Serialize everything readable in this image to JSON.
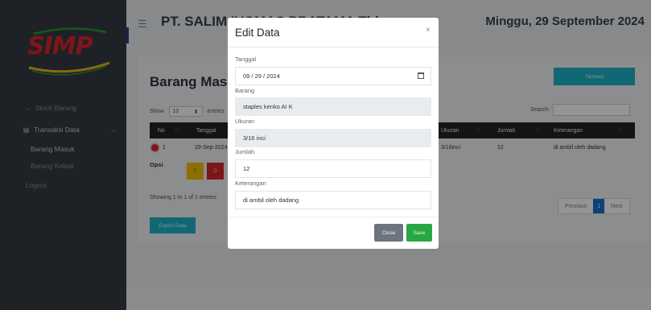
{
  "sidebar": {
    "logo_text": "SIMP",
    "items": [
      {
        "label": "Stock Barang",
        "icon": "arrow-right-icon"
      },
      {
        "label": "Transaksi Data",
        "icon": "table-icon"
      }
    ],
    "subitems": [
      {
        "label": "Barang Masuk"
      },
      {
        "label": "Barang Keluar"
      }
    ],
    "logout_label": "Logout"
  },
  "topbar": {
    "company": "PT. SALIM IVOMAS PRATAMA Tbk",
    "date": "Minggu, 29 September 2024"
  },
  "card": {
    "title": "Barang Masuk",
    "tambah_label": "Tambah",
    "show_label": "Show",
    "show_value": "10",
    "entries_label": "entries",
    "search_label": "Search:",
    "columns": {
      "no": "No",
      "tanggal": "Tanggal",
      "ukuran": "Ukuran",
      "jumlah": "Jumlah",
      "keterangan": "Keterangan"
    },
    "row": {
      "no": "1",
      "tanggal": "29-Sep-2024",
      "ukuran": "3/16inci",
      "jumlah": "12",
      "keterangan": "di ambil oleh dadang"
    },
    "opsi_label": "Opsi",
    "edit_label": "E",
    "delete_label": "D",
    "showing_text": "Showing 1 to 1 of 1 entries",
    "pagination": {
      "previous": "Previous",
      "current": "1",
      "next": "Next"
    },
    "export_label": "Export Data"
  },
  "modal": {
    "title": "Edit Data",
    "close_icon": "×",
    "fields": {
      "tanggal": {
        "label": "Tanggal",
        "value": "09 / 29 / 2024"
      },
      "barang": {
        "label": "Barang",
        "value": "staples kenko AI K"
      },
      "ukuran": {
        "label": "Ukuran",
        "value": "3/16 inci"
      },
      "jumlah": {
        "label": "Jumlah",
        "value": "12"
      },
      "keterangan": {
        "label": "Keterangan",
        "value": "di ambil oleh dadang"
      }
    },
    "close_label": "Close",
    "save_label": "Save"
  },
  "colors": {
    "sidebar_bg": "#343a40",
    "accent_teal": "#1cb3c8",
    "save_green": "#28a745",
    "close_gray": "#6c757d",
    "danger_red": "#d8262c",
    "warning_yellow": "#f5c000",
    "page_blue": "#1b6fd0"
  }
}
